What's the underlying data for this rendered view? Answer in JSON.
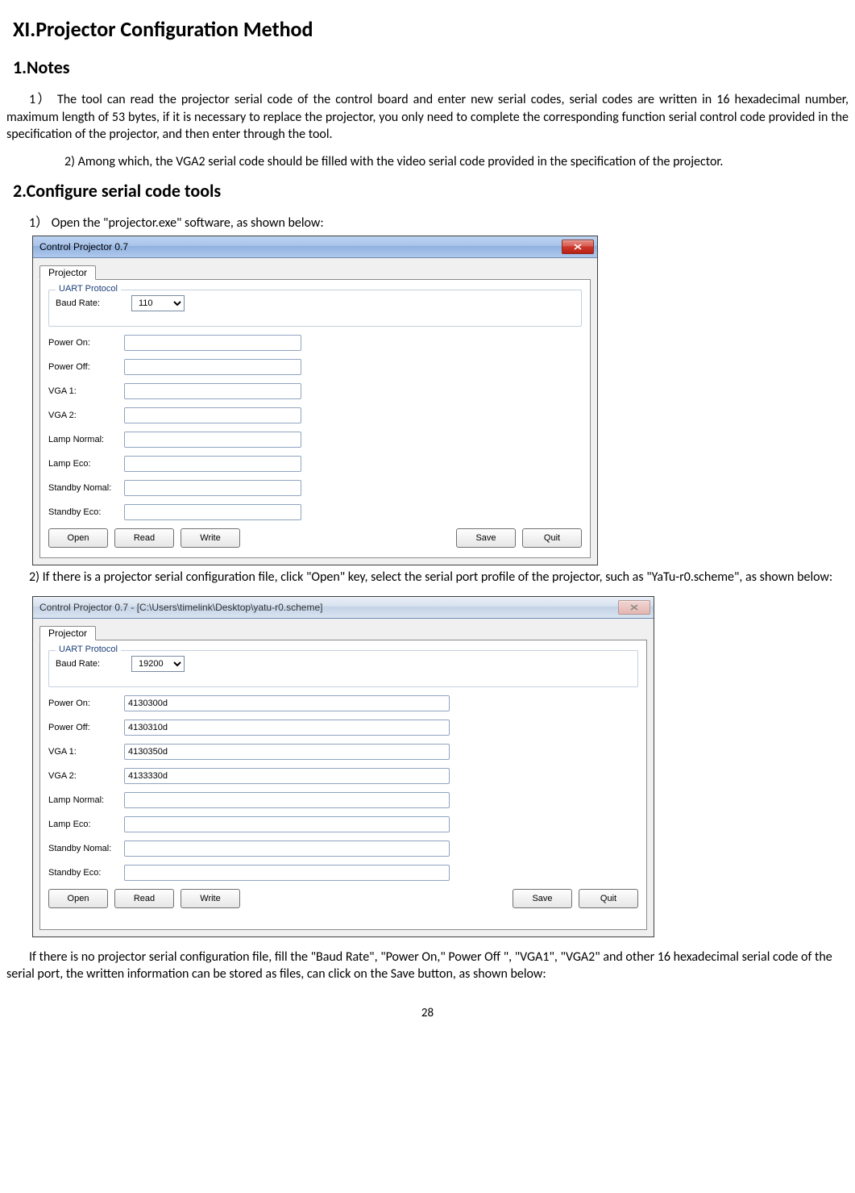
{
  "page": {
    "h1": "XI.Projector Configuration Method",
    "h2_notes": "1.Notes",
    "notes_p1": "1）  The tool can read the projector serial code of the control board and enter new serial codes, serial codes are written in 16 hexadecimal number, maximum length of 53 bytes, if it is necessary to replace the projector, you only need to complete the corresponding function serial control code provided in the specification of the projector, and then enter through the tool.",
    "notes_p2": "2) Among which, the VGA2 serial code should be filled with the video serial code provided in the specification of the projector.",
    "h2_config": "2.Configure serial code tools",
    "config_p1": "1）  Open the \"projector.exe\" software, as shown below:",
    "config_p2": "2) If there is a projector serial configuration file, click \"Open\" key, select the serial port profile of the projector, such as \"YaTu-r0.scheme\", as shown below:",
    "config_p3": "If there is no projector serial configuration file, fill the \"Baud Rate\", \"Power On,\" Power Off \", \"VGA1\", \"VGA2\" and other 16 hexadecimal serial code of the serial port, the written information can be stored as files, can click on the Save button, as shown below:",
    "page_number": "28"
  },
  "win1": {
    "title": "Control Projector 0.7",
    "tab": "Projector",
    "group": "UART Protocol",
    "baud_label": "Baud Rate:",
    "baud_value": "110",
    "fields": {
      "power_on": "Power On:",
      "power_off": "Power Off:",
      "vga1": "VGA 1:",
      "vga2": "VGA 2:",
      "lamp_normal": "Lamp Normal:",
      "lamp_eco": "Lamp Eco:",
      "standby_normal": "Standby Nomal:",
      "standby_eco": "Standby Eco:"
    },
    "buttons": {
      "open": "Open",
      "read": "Read",
      "write": "Write",
      "save": "Save",
      "quit": "Quit"
    }
  },
  "win2": {
    "title": "Control Projector 0.7 - [C:\\Users\\timelink\\Desktop\\yatu-r0.scheme]",
    "tab": "Projector",
    "group": "UART Protocol",
    "baud_label": "Baud Rate:",
    "baud_value": "19200",
    "fields": {
      "power_on": {
        "label": "Power On:",
        "value": "4130300d"
      },
      "power_off": {
        "label": "Power Off:",
        "value": "4130310d"
      },
      "vga1": {
        "label": "VGA 1:",
        "value": "4130350d"
      },
      "vga2": {
        "label": "VGA 2:",
        "value": "4133330d"
      },
      "lamp_normal": {
        "label": "Lamp Normal:",
        "value": ""
      },
      "lamp_eco": {
        "label": "Lamp Eco:",
        "value": ""
      },
      "standby_normal": {
        "label": "Standby Nomal:",
        "value": ""
      },
      "standby_eco": {
        "label": "Standby Eco:",
        "value": ""
      }
    },
    "buttons": {
      "open": "Open",
      "read": "Read",
      "write": "Write",
      "save": "Save",
      "quit": "Quit"
    }
  }
}
